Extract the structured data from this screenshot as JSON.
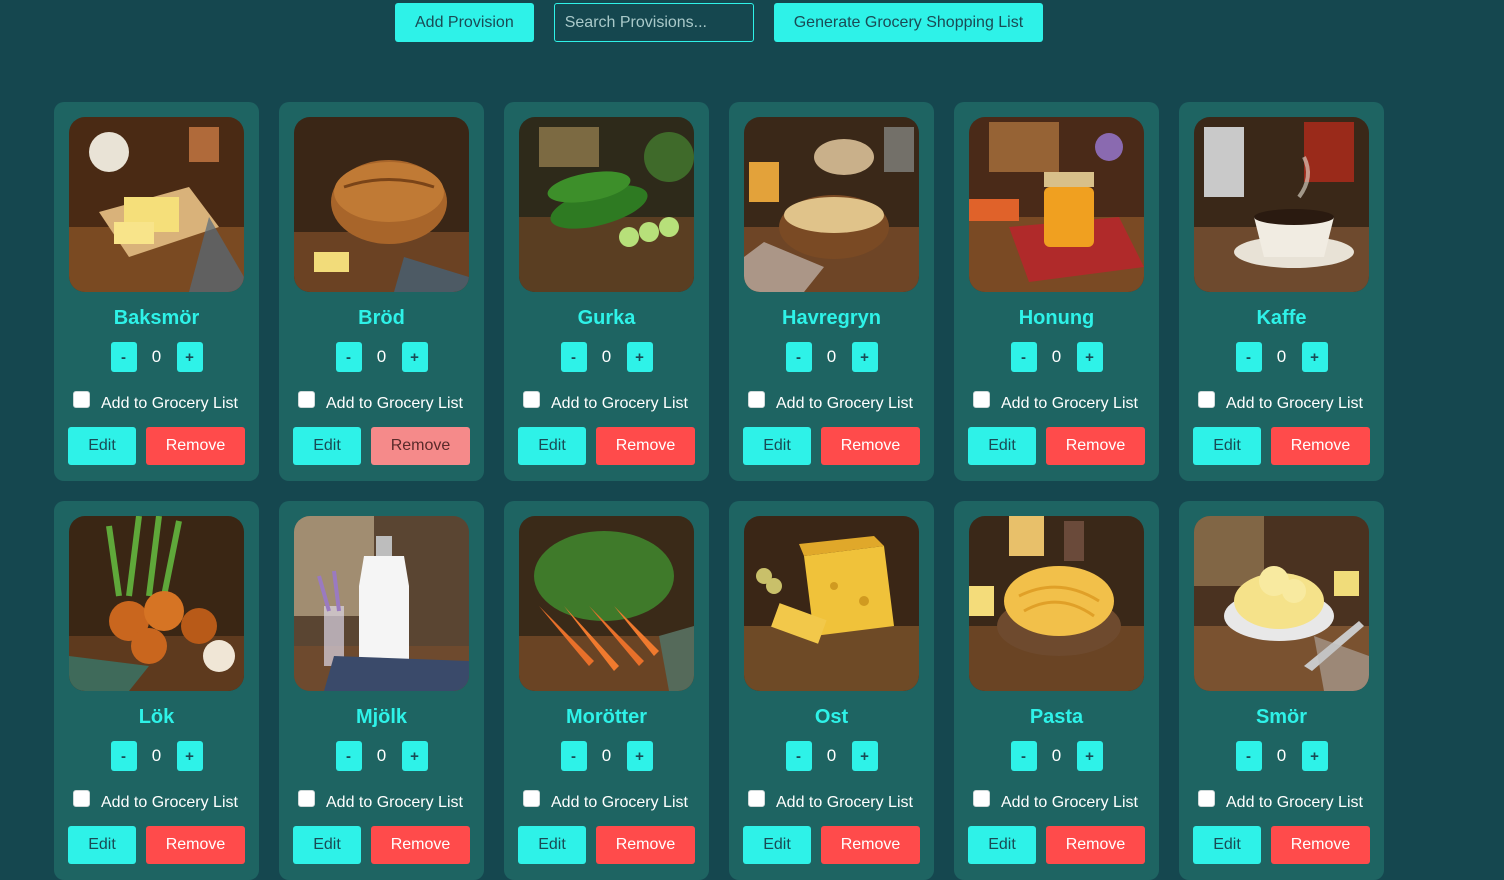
{
  "toolbar": {
    "add_label": "Add Provision",
    "search_placeholder": "Search Provisions...",
    "generate_label": "Generate Grocery Shopping List"
  },
  "card_common": {
    "minus": "-",
    "plus": "+",
    "grocery_label": "Add to Grocery List",
    "edit_label": "Edit",
    "remove_label": "Remove"
  },
  "colors": {
    "background": "#15474f",
    "card": "#1e6462",
    "accent": "#2ef2e8",
    "remove": "#ff4b4b",
    "remove_hover": "#f58a8a"
  },
  "provisions": [
    {
      "name": "Baksmör",
      "qty": "0",
      "image": "butter-image",
      "hovered": false
    },
    {
      "name": "Bröd",
      "qty": "0",
      "image": "bread-image",
      "hovered": true
    },
    {
      "name": "Gurka",
      "qty": "0",
      "image": "cucumber-image",
      "hovered": false
    },
    {
      "name": "Havregryn",
      "qty": "0",
      "image": "oats-image",
      "hovered": false
    },
    {
      "name": "Honung",
      "qty": "0",
      "image": "honey-image",
      "hovered": false
    },
    {
      "name": "Kaffe",
      "qty": "0",
      "image": "coffee-image",
      "hovered": false
    },
    {
      "name": "Lök",
      "qty": "0",
      "image": "onion-image",
      "hovered": false
    },
    {
      "name": "Mjölk",
      "qty": "0",
      "image": "milk-image",
      "hovered": false
    },
    {
      "name": "Morötter",
      "qty": "0",
      "image": "carrot-image",
      "hovered": false
    },
    {
      "name": "Ost",
      "qty": "0",
      "image": "cheese-image",
      "hovered": false
    },
    {
      "name": "Pasta",
      "qty": "0",
      "image": "pasta-image",
      "hovered": false
    },
    {
      "name": "Smör",
      "qty": "0",
      "image": "whipped-butter-image",
      "hovered": false
    }
  ]
}
